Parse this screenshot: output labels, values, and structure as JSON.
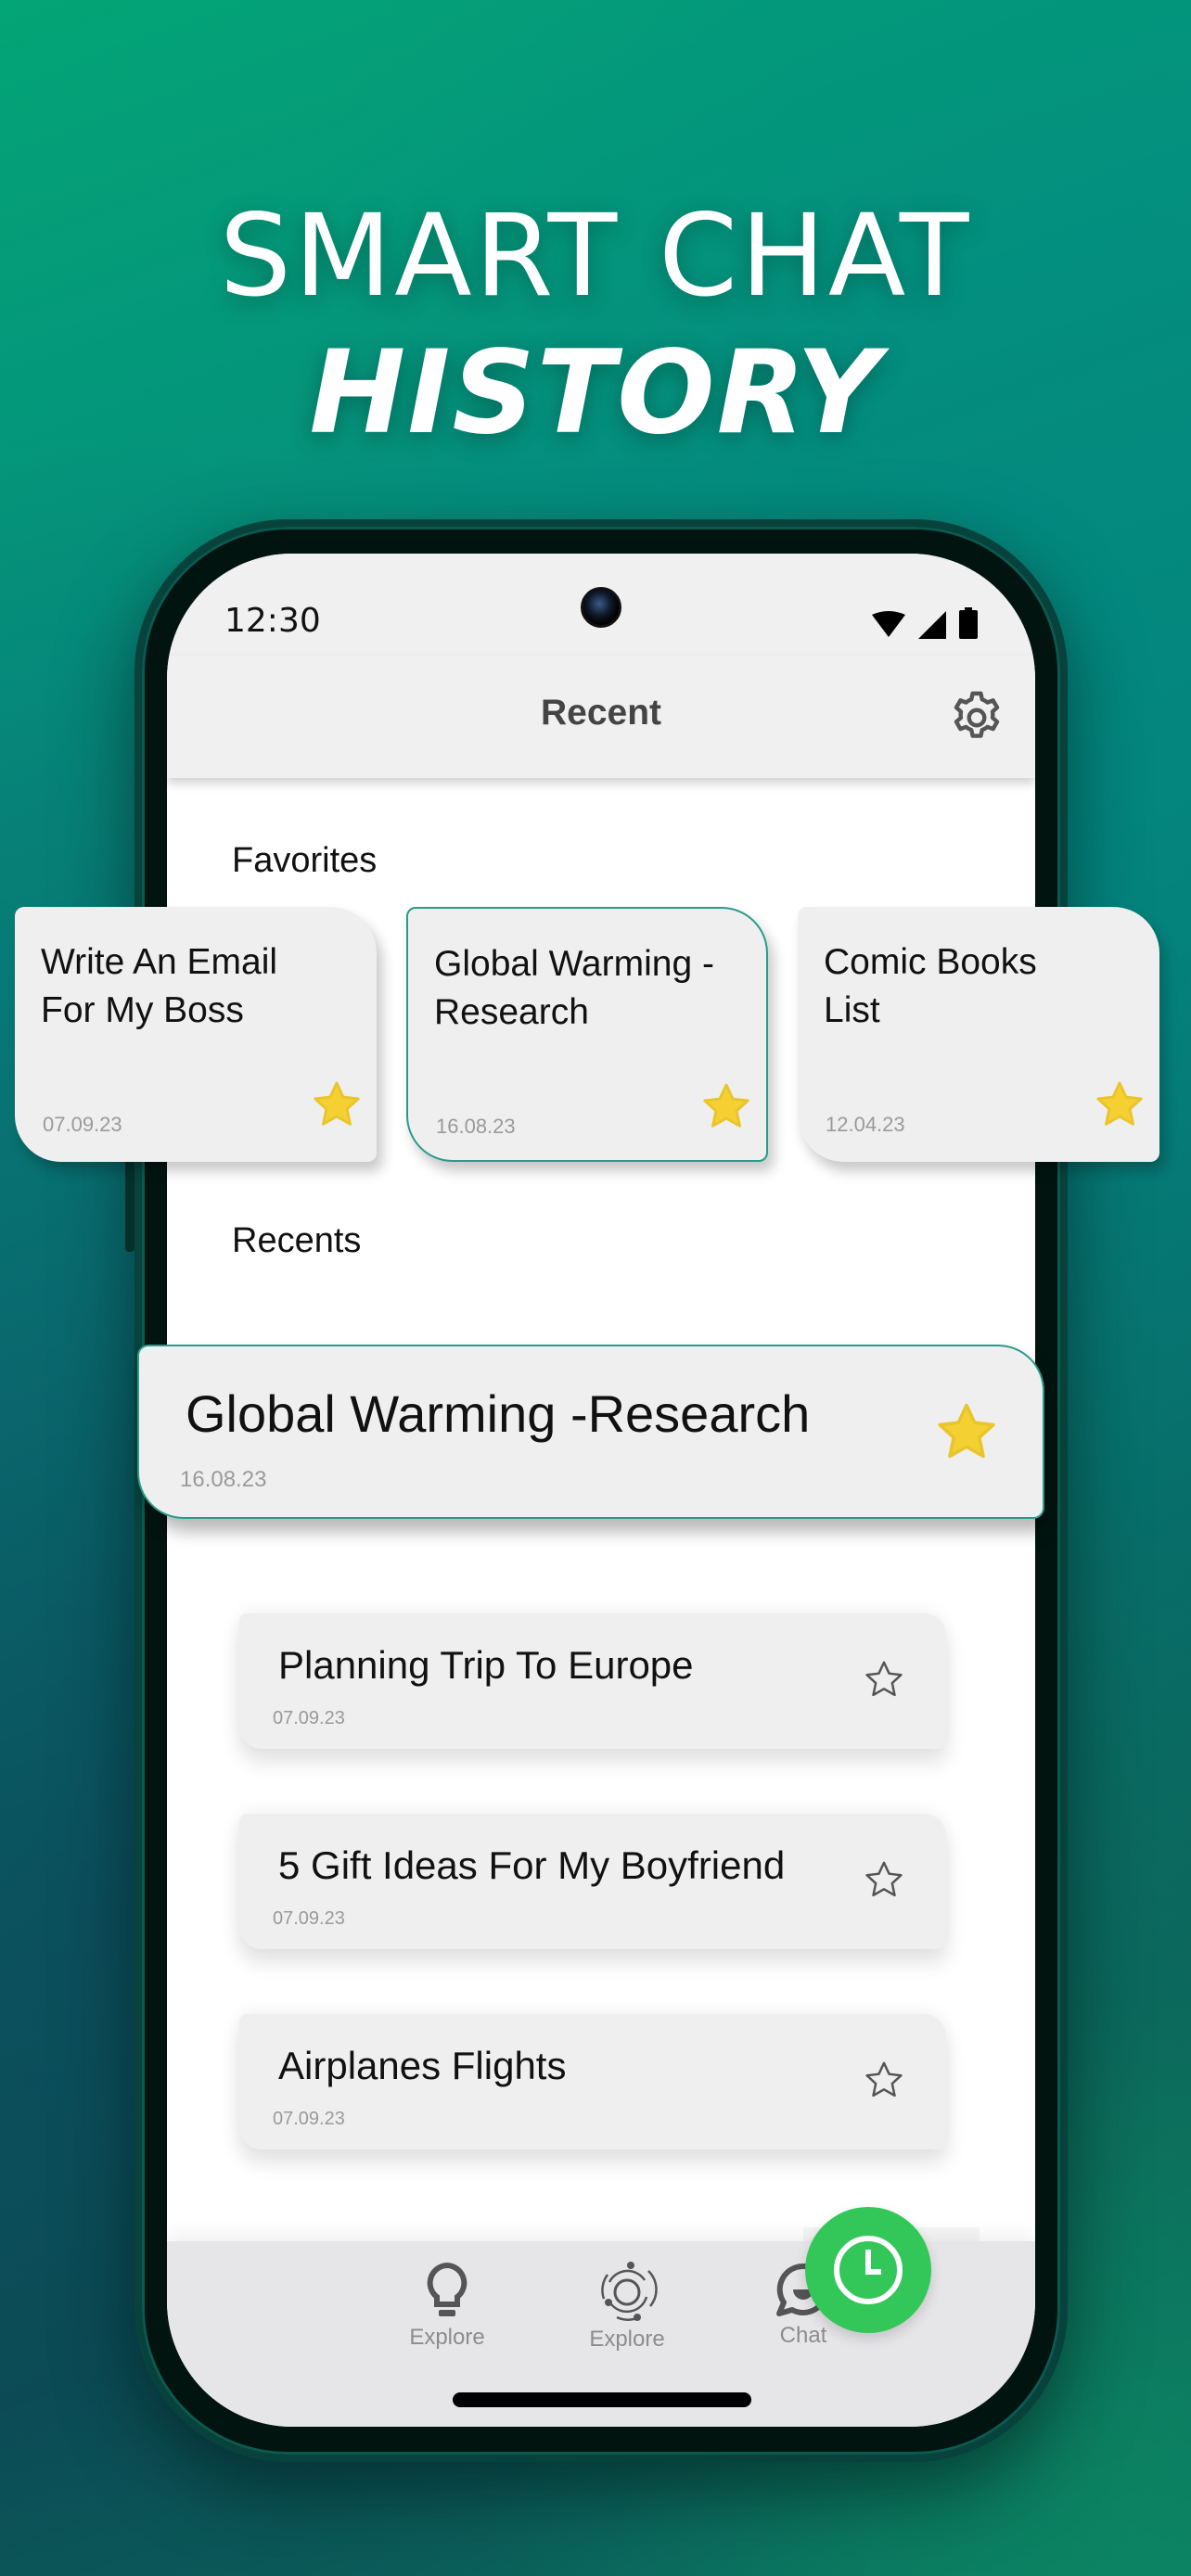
{
  "promo": {
    "headline_line1": "SMART CHAT",
    "headline_line2": "HISTORY"
  },
  "status_bar": {
    "time": "12:30",
    "icons": [
      "wifi-icon",
      "signal-icon",
      "battery-icon"
    ]
  },
  "header": {
    "title": "Recent",
    "settings_icon": "gear-icon"
  },
  "favorites": {
    "label": "Favorites",
    "items": [
      {
        "title": "Write An Email For My Boss",
        "date": "07.09.23",
        "starred": true,
        "selected": false
      },
      {
        "title": "Global Warming -Research",
        "date": "16.08.23",
        "starred": true,
        "selected": true
      },
      {
        "title": "Comic Books List",
        "date": "12.04.23",
        "starred": true,
        "selected": false
      }
    ]
  },
  "recents": {
    "label": "Recents",
    "highlighted": {
      "title": "Global Warming -Research",
      "date": "16.08.23",
      "starred": true
    },
    "items": [
      {
        "title": "Planning Trip To Europe",
        "date": "07.09.23",
        "starred": false
      },
      {
        "title": "5 Gift Ideas For My Boyfriend",
        "date": "07.09.23",
        "starred": false
      },
      {
        "title": "Airplanes Flights",
        "date": "07.09.23",
        "starred": false
      }
    ]
  },
  "bottom_nav": {
    "items": [
      {
        "label": "Explore",
        "icon": "lightbulb-icon"
      },
      {
        "label": "Explore",
        "icon": "orbit-icon"
      },
      {
        "label": "Chat",
        "icon": "chat-bubble-icon"
      }
    ],
    "fab_icon": "clock-icon"
  },
  "colors": {
    "accent_green": "#33c75a",
    "star_gold": "#f5d033",
    "selected_border": "#2a9c8a",
    "date_gray": "#9a9a9a"
  }
}
